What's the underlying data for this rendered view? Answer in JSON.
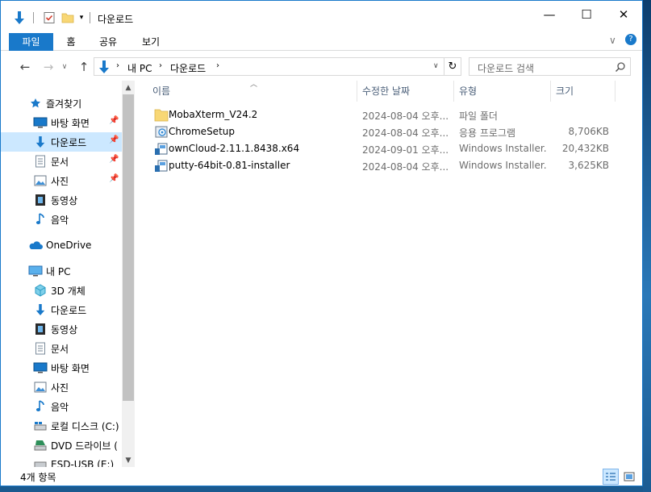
{
  "window": {
    "title": "다운로드"
  },
  "ribbon": {
    "tabs": [
      "파일",
      "홈",
      "공유",
      "보기"
    ]
  },
  "address": {
    "crumbs": [
      "내 PC",
      "다운로드"
    ],
    "search_placeholder": "다운로드 검색"
  },
  "nav": {
    "quick_access": "즐겨찾기",
    "quick_items": [
      "바탕 화면",
      "다운로드",
      "문서",
      "사진",
      "동영상",
      "음악"
    ],
    "onedrive": "OneDrive",
    "this_pc": "내 PC",
    "pc_items": [
      "3D 개체",
      "다운로드",
      "동영상",
      "문서",
      "바탕 화면",
      "사진",
      "음악",
      "로컬 디스크 (C:)",
      "DVD 드라이브 (",
      "ESD-USB (E:)"
    ]
  },
  "columns": {
    "name": "이름",
    "date": "수정한 날짜",
    "type": "유형",
    "size": "크기"
  },
  "files": [
    {
      "name": "MobaXterm_V24.2",
      "date": "2024-08-04 오후...",
      "type": "파일 폴더",
      "size": "",
      "icon": "folder-icon"
    },
    {
      "name": "ChromeSetup",
      "date": "2024-08-04 오후...",
      "type": "응용 프로그램",
      "size": "8,706KB",
      "icon": "setup-exe-icon"
    },
    {
      "name": "ownCloud-2.11.1.8438.x64",
      "date": "2024-09-01 오후...",
      "type": "Windows Installer...",
      "size": "20,432KB",
      "icon": "msi-installer-icon"
    },
    {
      "name": "putty-64bit-0.81-installer",
      "date": "2024-08-04 오후...",
      "type": "Windows Installer...",
      "size": "3,625KB",
      "icon": "msi-installer-icon"
    }
  ],
  "status": {
    "item_count": "4개 항목"
  },
  "colors": {
    "accent": "#1979ca",
    "selection": "#cce8ff",
    "header_text": "#4c607a"
  }
}
